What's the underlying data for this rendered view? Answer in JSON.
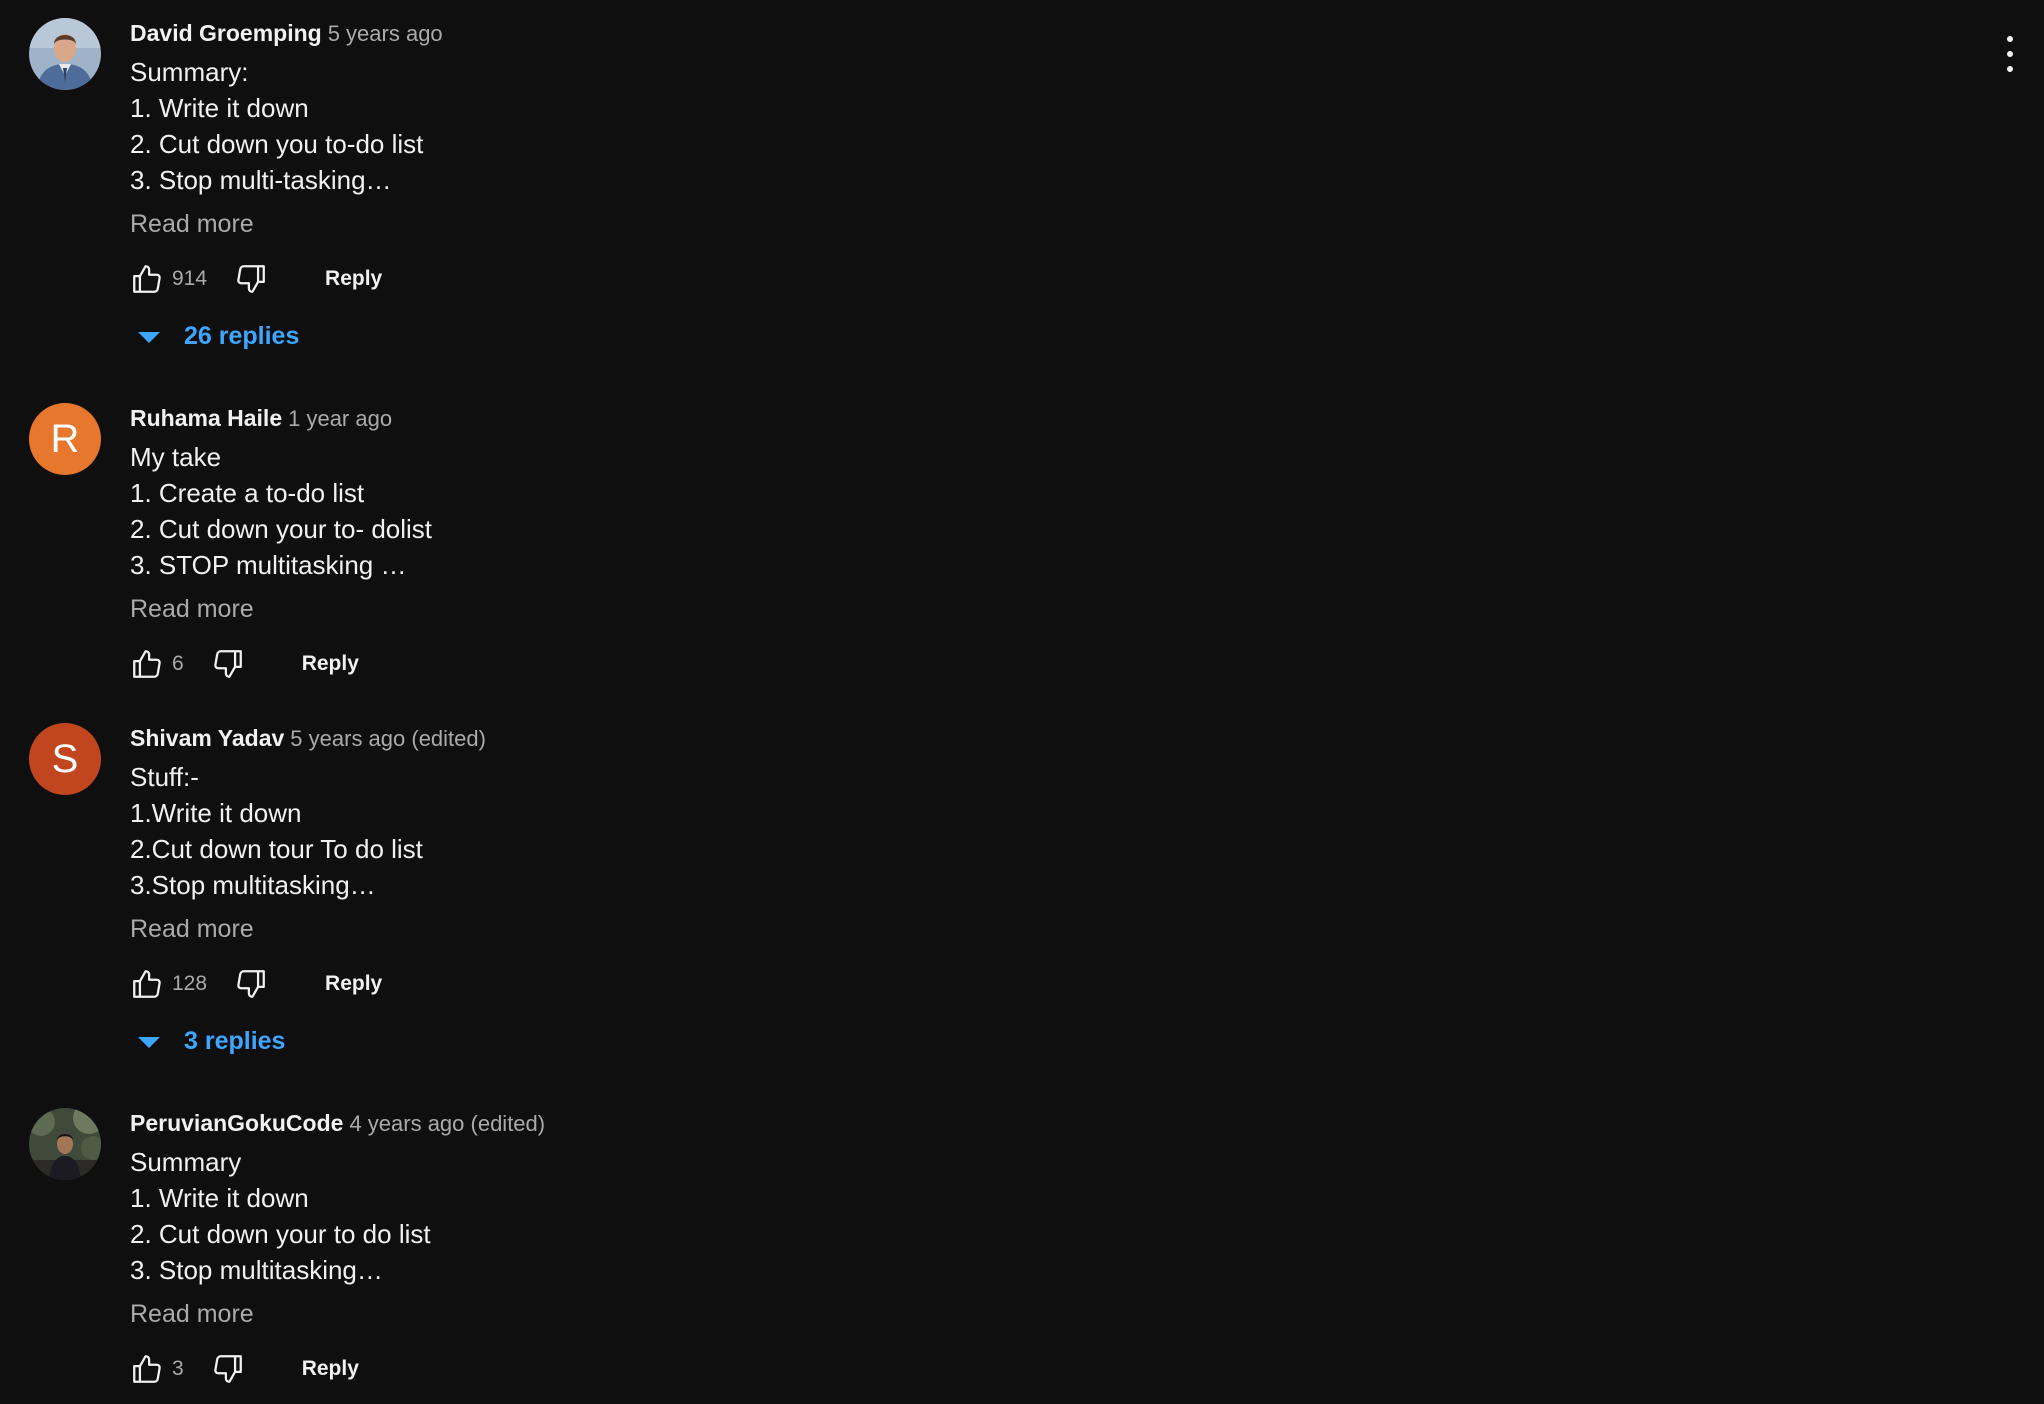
{
  "comments": [
    {
      "author": "David Groemping",
      "time": "5 years ago",
      "lines": [
        "Summary:",
        "1. Write it down",
        "2. Cut down you to-do list",
        "3. Stop multi-tasking…"
      ],
      "read_more": "Read more",
      "likes": "914",
      "reply_label": "Reply",
      "replies_label": "26 replies",
      "avatar": "photo-man-icon"
    },
    {
      "author": "Ruhama Haile",
      "time": "1 year ago",
      "lines": [
        "My take",
        "1. Create a to-do list",
        "2. Cut down your to- dolist",
        "3. STOP multitasking …"
      ],
      "read_more": "Read more",
      "likes": "6",
      "reply_label": "Reply",
      "avatar_letter": "R",
      "avatar_color": "#e8772e"
    },
    {
      "author": "Shivam Yadav",
      "time": "5 years ago (edited)",
      "lines": [
        "Stuff:-",
        "1.Write it down",
        "2.Cut down tour To do list",
        "3.Stop multitasking…"
      ],
      "read_more": "Read more",
      "likes": "128",
      "reply_label": "Reply",
      "replies_label": "3 replies",
      "avatar_letter": "S",
      "avatar_color": "#c1461f"
    },
    {
      "author": "PeruvianGokuCode",
      "time": "4 years ago (edited)",
      "lines": [
        "Summary",
        "1. Write it down",
        "2. Cut down your to do list",
        "3. Stop multitasking…"
      ],
      "read_more": "Read more",
      "likes": "3",
      "reply_label": "Reply",
      "avatar": "photo-person-outdoors-icon"
    }
  ],
  "colors": {
    "background": "#0f0f0f",
    "primary_text": "#f1f1f1",
    "secondary_text": "#aaaaaa",
    "link_blue": "#3ea6ff"
  }
}
